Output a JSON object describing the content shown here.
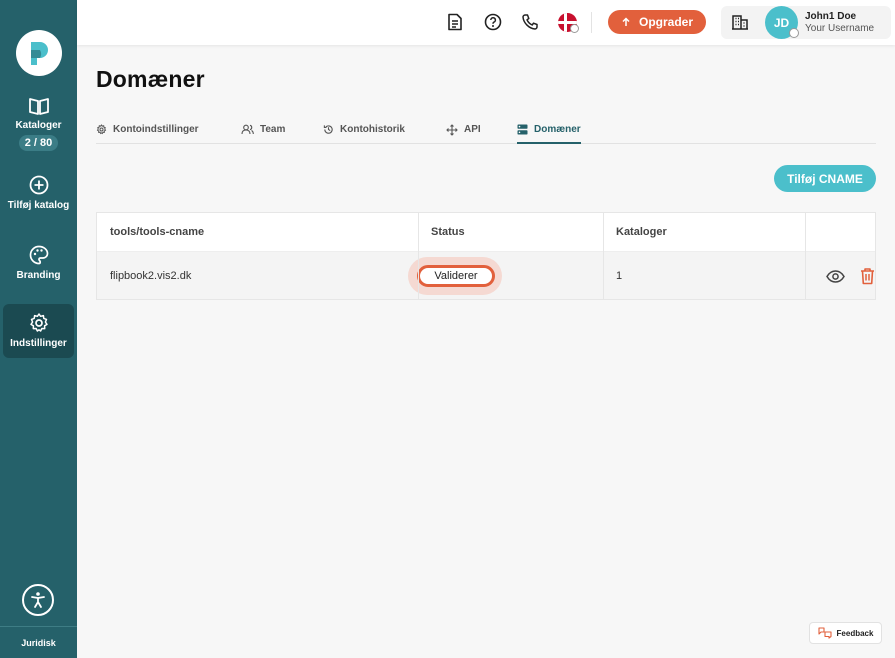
{
  "sidebar": {
    "items": [
      {
        "label": "Kataloger",
        "badge": "2 / 80",
        "icon": "book-open-icon"
      },
      {
        "label": "Tilføj katalog",
        "icon": "plus-circle-icon"
      },
      {
        "label": "Branding",
        "icon": "palette-icon"
      },
      {
        "label": "Indstillinger",
        "icon": "gear-icon",
        "active": true
      }
    ],
    "legal_label": "Juridisk"
  },
  "topbar": {
    "upgrade_label": "Opgrader",
    "user": {
      "initials": "JD",
      "name": "John1 Doe",
      "username": "Your Username"
    }
  },
  "page": {
    "title": "Domæner",
    "tabs": [
      {
        "label": "Kontoindstillinger",
        "icon": "gear-icon"
      },
      {
        "label": "Team",
        "icon": "users-icon"
      },
      {
        "label": "Kontohistorik",
        "icon": "history-icon"
      },
      {
        "label": "API",
        "icon": "move-icon"
      },
      {
        "label": "Domæner",
        "icon": "server-icon",
        "active": true
      }
    ],
    "add_button_label": "Tilføj CNAME",
    "table": {
      "headers": [
        "tools/tools-cname",
        "Status",
        "Kataloger",
        ""
      ],
      "rows": [
        {
          "domain": "flipbook2.vis2.dk",
          "status": "Validerer",
          "catalogs": "1"
        }
      ]
    }
  },
  "feedback_label": "Feedback",
  "colors": {
    "sidebar": "#25616a",
    "accent": "#4bbfcb",
    "upgrade": "#e2603c",
    "delete": "#e2603c"
  }
}
